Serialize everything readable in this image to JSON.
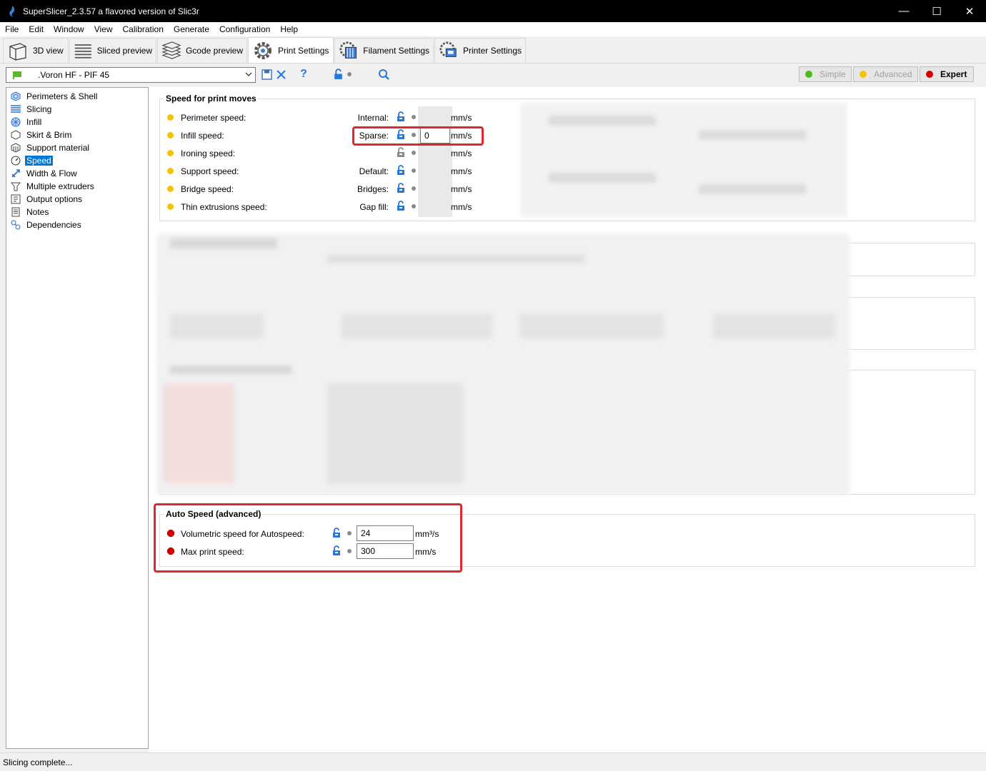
{
  "window": {
    "title": "SuperSlicer_2.3.57 a flavored version of Slic3r",
    "minimize": "—",
    "maximize": "☐",
    "close": "✕"
  },
  "menu": [
    "File",
    "Edit",
    "Window",
    "View",
    "Calibration",
    "Generate",
    "Configuration",
    "Help"
  ],
  "tabs": [
    {
      "label": "3D view",
      "icon": "cube-icon"
    },
    {
      "label": "Sliced preview",
      "icon": "layers-icon"
    },
    {
      "label": "Gcode preview",
      "icon": "gcode-layers-icon"
    },
    {
      "label": "Print Settings",
      "icon": "cog-icon",
      "active": true
    },
    {
      "label": "Filament Settings",
      "icon": "filament-spool-icon"
    },
    {
      "label": "Printer Settings",
      "icon": "printer-cog-icon"
    }
  ],
  "preset": {
    "name": ".Voron HF - PIF 45",
    "help": "?"
  },
  "modes": [
    {
      "label": "Simple",
      "color": "#4cbb17"
    },
    {
      "label": "Advanced",
      "color": "#f4c300"
    },
    {
      "label": "Expert",
      "color": "#d00000"
    }
  ],
  "tree": [
    {
      "label": "Perimeters & Shell",
      "icon": "perimeters-icon"
    },
    {
      "label": "Slicing",
      "icon": "slicing-icon"
    },
    {
      "label": "Infill",
      "icon": "infill-icon"
    },
    {
      "label": "Skirt & Brim",
      "icon": "skirt-icon"
    },
    {
      "label": "Support material",
      "icon": "support-icon"
    },
    {
      "label": "Speed",
      "icon": "speed-icon",
      "selected": true
    },
    {
      "label": "Width & Flow",
      "icon": "width-flow-icon"
    },
    {
      "label": "Multiple extruders",
      "icon": "extruders-icon"
    },
    {
      "label": "Output options",
      "icon": "output-icon"
    },
    {
      "label": "Notes",
      "icon": "notes-icon"
    },
    {
      "label": "Dependencies",
      "icon": "dependencies-icon"
    }
  ],
  "speed_group": {
    "title": "Speed for print moves",
    "unit": "mm/s",
    "rows": [
      {
        "label": "Perimeter speed:",
        "sub": "Internal:"
      },
      {
        "label": "Infill speed:",
        "sub": "Sparse:",
        "value": "0"
      },
      {
        "label": "Ironing speed:",
        "sub": ""
      },
      {
        "label": "Support speed:",
        "sub": "Default:"
      },
      {
        "label": "Bridge speed:",
        "sub": "Bridges:"
      },
      {
        "label": "Thin extrusions speed:",
        "sub": "Gap fill:"
      }
    ]
  },
  "auto_speed": {
    "title": "Auto Speed (advanced)",
    "rows": [
      {
        "label": "Volumetric speed for Autospeed:",
        "value": "24",
        "unit": "mm³/s"
      },
      {
        "label": "Max print speed:",
        "value": "300",
        "unit": "mm/s"
      }
    ]
  },
  "status": "Slicing complete..."
}
